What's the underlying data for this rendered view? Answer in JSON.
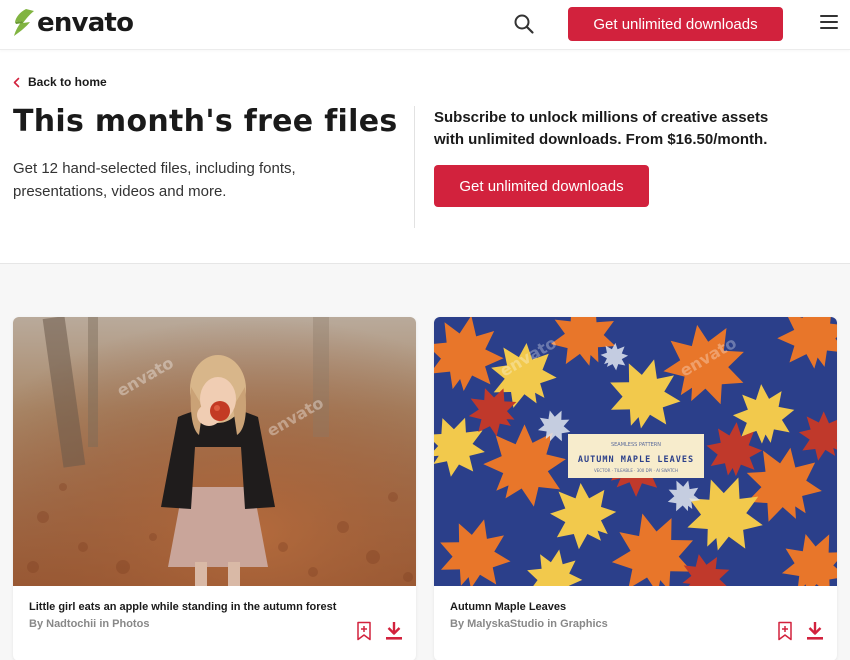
{
  "header": {
    "logo_text": "envato",
    "cta_label": "Get unlimited downloads",
    "icons": {
      "search": "search-icon",
      "menu": "hamburger-menu-icon",
      "logo": "envato-leaf-logo"
    }
  },
  "hero": {
    "back_label": "Back to home",
    "title": "This month's free files",
    "description": "Get 12 hand-selected files, including fonts, presentations, videos and more.",
    "subscribe_text": "Subscribe to unlock millions of creative assets with unlimited downloads. From $16.50/month.",
    "cta_label": "Get unlimited downloads"
  },
  "cards": [
    {
      "title": "Little girl eats an apple while standing in the autumn forest",
      "by": "By",
      "author": "Nadtochii",
      "in": "in",
      "category": "Photos",
      "watermark": "envato"
    },
    {
      "title": "Autumn Maple Leaves",
      "by": "By",
      "author": "MalyskaStudio",
      "in": "in",
      "category": "Graphics",
      "pattern_label_top": "SEAMLESS PATTERN",
      "pattern_label_main": "AUTUMN MAPLE LEAVES",
      "pattern_label_bottom": "VECTOR · TILEABLE · 300 DPI · AI SWATCH",
      "watermark": "envato"
    }
  ],
  "colors": {
    "accent": "#d2223d",
    "logo_green": "#81b441",
    "text": "#1a1a1a",
    "muted": "#888888",
    "grid_bg": "#f7f7f7"
  }
}
